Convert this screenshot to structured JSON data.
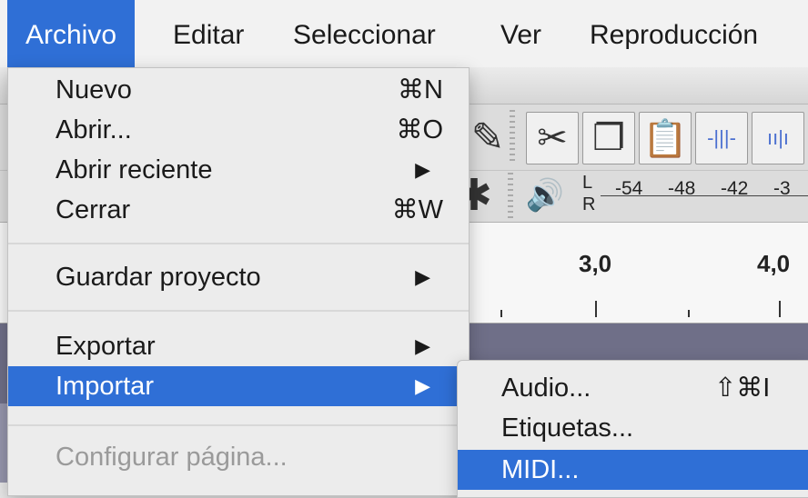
{
  "menubar": {
    "items": [
      "Archivo",
      "Editar",
      "Seleccionar",
      "Ver",
      "Reproducción"
    ],
    "active": "Archivo"
  },
  "file_menu": {
    "items": [
      {
        "label": "Nuevo",
        "shortcut": "⌘N"
      },
      {
        "label": "Abrir...",
        "shortcut": "⌘O"
      },
      {
        "label": "Abrir reciente",
        "submenu": true
      },
      {
        "label": "Cerrar",
        "shortcut": "⌘W"
      },
      {
        "label": "Guardar proyecto",
        "submenu": true
      },
      {
        "label": "Exportar",
        "submenu": true
      },
      {
        "label": "Importar",
        "submenu": true,
        "highlighted": true
      },
      {
        "label": "Configurar página...",
        "disabled": true
      }
    ]
  },
  "import_submenu": {
    "items": [
      {
        "label": "Audio...",
        "shortcut": "⇧⌘I"
      },
      {
        "label": "Etiquetas..."
      },
      {
        "label": "MIDI...",
        "highlighted": true
      }
    ]
  },
  "meter": {
    "channel_l": "L",
    "channel_r": "R",
    "ticks": [
      "-54",
      "-48",
      "-42",
      "-3"
    ]
  },
  "timeline": {
    "labels": [
      "3,0",
      "4,0"
    ]
  },
  "colors": {
    "highlight": "#2f6fd6",
    "track_background": "#9696ad"
  }
}
